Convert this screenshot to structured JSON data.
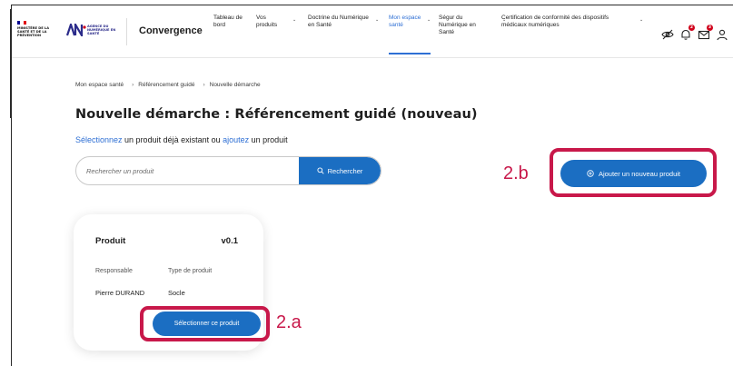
{
  "app": {
    "brand": "Convergence",
    "gov_logo_text": "MINISTÈRE DE LA SANTÉ ET DE LA PRÉVENTION",
    "agency_logo_text": "AGENCE DU NUMÉRIQUE EN SANTÉ"
  },
  "nav": {
    "items": [
      {
        "label": "Tableau de bord",
        "has_menu": false,
        "active": false
      },
      {
        "label": "Vos produits",
        "has_menu": true,
        "active": false
      },
      {
        "label": "Doctrine du Numérique en Santé",
        "has_menu": true,
        "active": false
      },
      {
        "label": "Mon espace santé",
        "has_menu": true,
        "active": true
      },
      {
        "label": "Ségur du Numérique en Santé",
        "has_menu": true,
        "active": false
      },
      {
        "label": "Certification de conformité des dispositifs médicaux numériques",
        "has_menu": true,
        "active": false
      }
    ]
  },
  "header_icons": [
    {
      "name": "eye-off-icon"
    },
    {
      "name": "bell-icon",
      "badge": "2"
    },
    {
      "name": "mail-icon",
      "badge": "3"
    },
    {
      "name": "user-icon"
    }
  ],
  "breadcrumb": [
    "Mon espace santé",
    "Référencement guidé",
    "Nouvelle démarche"
  ],
  "page": {
    "title": "Nouvelle démarche : Référencement guidé (nouveau)",
    "subtitle_link1": "Sélectionnez",
    "subtitle_mid": " un produit déjà existant ou ",
    "subtitle_link2": "ajoutez",
    "subtitle_end": " un produit"
  },
  "search": {
    "placeholder": "Rechercher un produit",
    "button_label": "Rechercher"
  },
  "add_button": {
    "label": "Ajouter un nouveau produit"
  },
  "annotations": {
    "a": "2.a",
    "b": "2.b"
  },
  "product_card": {
    "title": "Produit",
    "version": "v0.1",
    "responsable_label": "Responsable",
    "responsable_value": "Pierre DURAND",
    "type_label": "Type de produit",
    "type_value": "Socle",
    "select_label": "Sélectionner ce produit"
  },
  "colors": {
    "primary": "#1b6ec2",
    "link": "#2e6fd4",
    "highlight": "#c8184a",
    "badge": "#d0021b"
  }
}
